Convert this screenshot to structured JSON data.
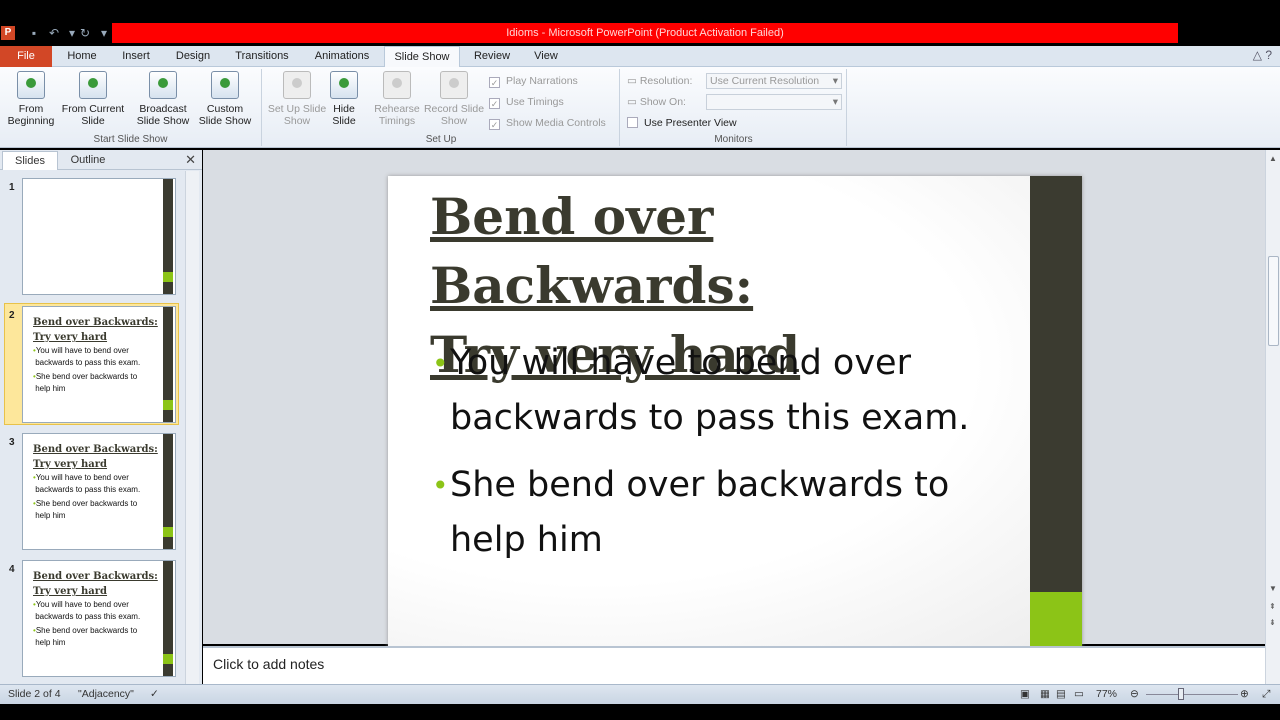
{
  "window": {
    "title": "Idioms  -  Microsoft PowerPoint (Product Activation Failed)",
    "app_logo": "P"
  },
  "tabs": [
    "File",
    "Home",
    "Insert",
    "Design",
    "Transitions",
    "Animations",
    "Slide Show",
    "Review",
    "View"
  ],
  "active_tab": "Slide Show",
  "ribbon": {
    "start_group": {
      "label": "Start Slide Show",
      "buttons": [
        "From Beginning",
        "From Current Slide",
        "Broadcast Slide Show",
        "Custom Slide Show"
      ]
    },
    "setup_group": {
      "label": "Set Up",
      "buttons": [
        "Set Up Slide Show",
        "Hide Slide",
        "Rehearse Timings",
        "Record Slide Show"
      ],
      "checkboxes": [
        "Play Narrations",
        "Use Timings",
        "Show Media Controls"
      ]
    },
    "monitors_group": {
      "label": "Monitors",
      "resolution_label": "Resolution:",
      "resolution_value": "Use Current Resolution",
      "show_on_label": "Show On:",
      "presenter_view": "Use Presenter View"
    }
  },
  "panel_tabs": [
    "Slides",
    "Outline"
  ],
  "thumbnails": [
    {
      "num": "1",
      "title_a": "",
      "title_b": "",
      "b1a": "",
      "b1b": "",
      "b2a": "",
      "b2b": ""
    },
    {
      "num": "2",
      "title_a": "Bend over Backwards:",
      "title_b": "Try very hard",
      "b1a": "You will have to bend over",
      "b1b": "backwards to pass this exam.",
      "b2a": "She bend over backwards to",
      "b2b": "help him"
    },
    {
      "num": "3",
      "title_a": "Bend over Backwards:",
      "title_b": "Try very hard",
      "b1a": "You will have to bend over",
      "b1b": "backwards to pass this exam.",
      "b2a": "She bend over backwards to",
      "b2b": "help him"
    },
    {
      "num": "4",
      "title_a": "Bend over Backwards:",
      "title_b": "Try very hard",
      "b1a": "You will have to bend over",
      "b1b": "backwards to pass this exam.",
      "b2a": "She bend over backwards to",
      "b2b": "help him"
    }
  ],
  "slide": {
    "title_line1": "Bend over Backwards:",
    "title_line2": "Try very hard",
    "bullet1_line1": "You will have to bend over",
    "bullet1_line2": "backwards to pass this exam.",
    "bullet2_line1": "She bend over backwards to",
    "bullet2_line2": "help him"
  },
  "notes_placeholder": "Click to add notes",
  "status": {
    "slide_pos": "Slide 2 of 4",
    "theme": "\"Adjacency\"",
    "zoom": "77%"
  },
  "colors": {
    "accent_green": "#8cc417",
    "bar_dark": "#3b3b30",
    "title_strip": "#ff0000",
    "file_tab": "#d24726"
  }
}
